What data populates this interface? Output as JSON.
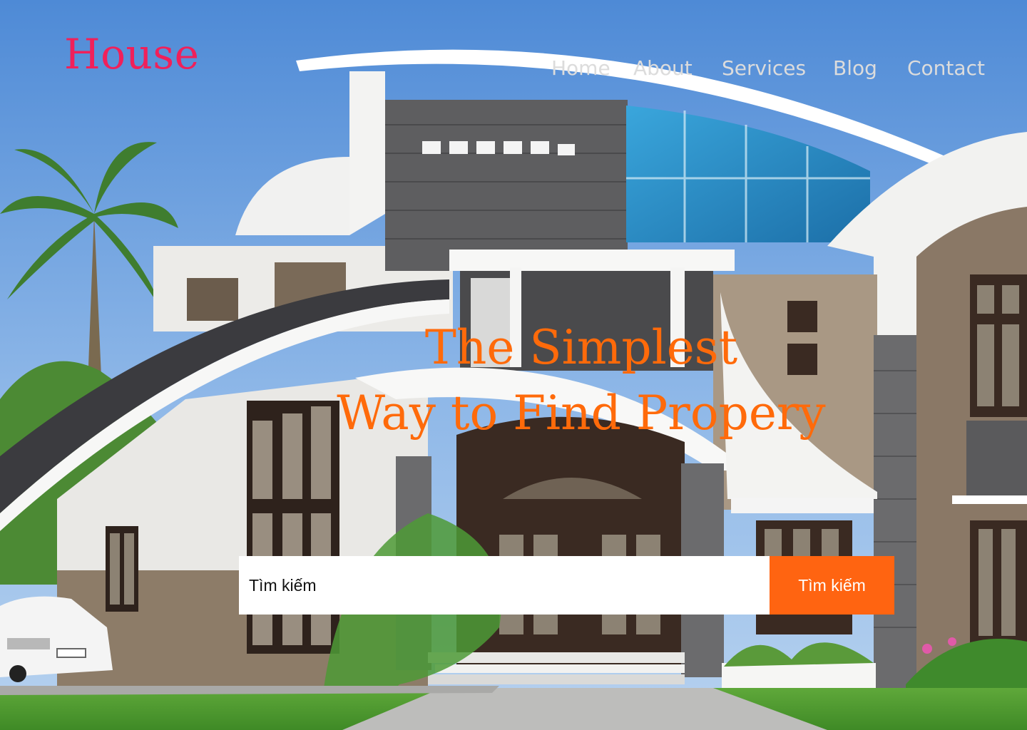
{
  "brand": {
    "name": "House"
  },
  "nav": {
    "items": [
      "Home",
      "About",
      "Services",
      "Blog",
      "Contact"
    ]
  },
  "hero": {
    "headline_line1": "The Simplest",
    "headline_line2": "Way to Find Propery"
  },
  "search": {
    "placeholder": "Tìm kiếm",
    "button_label": "Tìm kiếm"
  },
  "colors": {
    "brand": "#f0205a",
    "accent": "#ff6411",
    "headline": "#ff6a0a",
    "nav_text": "#dcdcdc"
  }
}
